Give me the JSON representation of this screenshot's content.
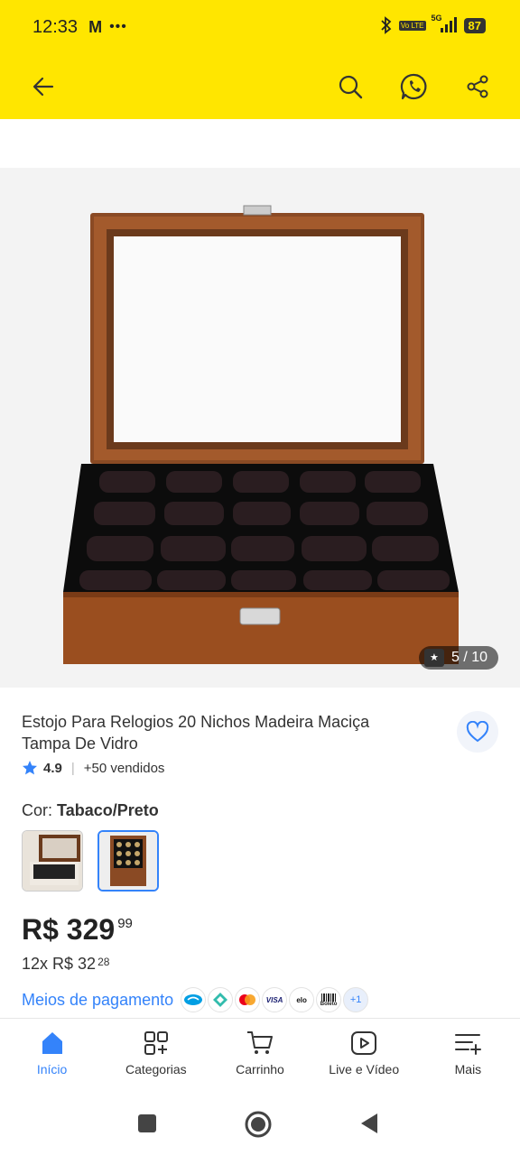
{
  "status_bar": {
    "time": "12:33",
    "carrier_icon": "M",
    "more": "•••",
    "network": "5G",
    "volte": "Vo LTE",
    "battery": "87"
  },
  "header": {
    "back_icon": "arrow-left-icon",
    "search_icon": "search-icon",
    "whatsapp_icon": "whatsapp-icon",
    "share_icon": "share-icon",
    "background": "#ffe600"
  },
  "gallery": {
    "counter": "5 / 10"
  },
  "product": {
    "title": "Estojo Para Relogios 20 Nichos Madeira Maciça Tampa De Vidro",
    "rating": "4.9",
    "sold": "+50 vendidos",
    "color_label": "Cor:",
    "color_value": "Tabaco/Preto",
    "price_int": "R$ 329",
    "price_cents": "99",
    "installments": "12x R$ 32",
    "installments_cents": "28",
    "payment_link": "Meios de pagamento",
    "payment_more": "+1",
    "payment_visa": "VISA",
    "payment_elo": "elo",
    "payment_boleto": "Boleto"
  },
  "bottom_nav": [
    {
      "label": "Início",
      "icon": "home-icon",
      "active": true
    },
    {
      "label": "Categorias",
      "icon": "categories-icon",
      "active": false
    },
    {
      "label": "Carrinho",
      "icon": "cart-icon",
      "active": false
    },
    {
      "label": "Live e Vídeo",
      "icon": "play-icon",
      "active": false
    },
    {
      "label": "Mais",
      "icon": "more-menu-icon",
      "active": false
    }
  ],
  "colors": {
    "accent": "#3483fa",
    "brand_yellow": "#ffe600"
  }
}
